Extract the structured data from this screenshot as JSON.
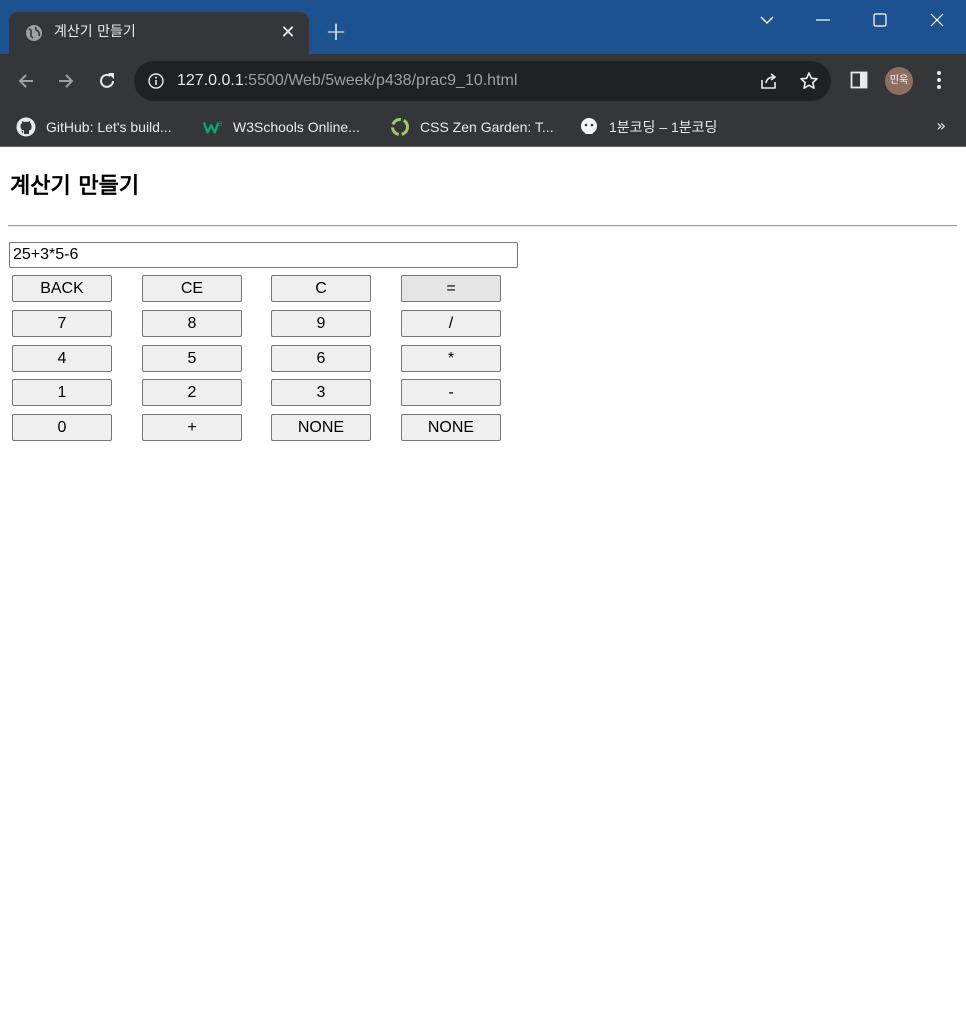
{
  "browser": {
    "tab_title": "계산기 만들기",
    "url_host": "127.0.0.1",
    "url_path": ":5500/Web/5week/p438/prac9_10.html",
    "profile_label": "민욱",
    "bookmarks": [
      {
        "label": "GitHub: Let's build...",
        "icon": "github-icon"
      },
      {
        "label": "W3Schools Online...",
        "icon": "w3schools-icon"
      },
      {
        "label": "CSS Zen Garden: T...",
        "icon": "zen-garden-icon"
      },
      {
        "label": "1분코딩 – 1분코딩",
        "icon": "1bun-coding-icon"
      }
    ],
    "more_bookmarks": "»"
  },
  "page": {
    "heading": "계산기 만들기",
    "display_value": "25+3*5-6",
    "buttons": [
      [
        "BACK",
        "CE",
        "C",
        "="
      ],
      [
        "7",
        "8",
        "9",
        "/"
      ],
      [
        "4",
        "5",
        "6",
        "*"
      ],
      [
        "1",
        "2",
        "3",
        "-"
      ],
      [
        "0",
        "+",
        "NONE",
        "NONE"
      ]
    ]
  },
  "colors": {
    "titlebar": "#1d5290",
    "chrome_dark": "#35363a",
    "omnibox": "#202124",
    "button_face": "#efefef",
    "button_border": "#767676"
  }
}
